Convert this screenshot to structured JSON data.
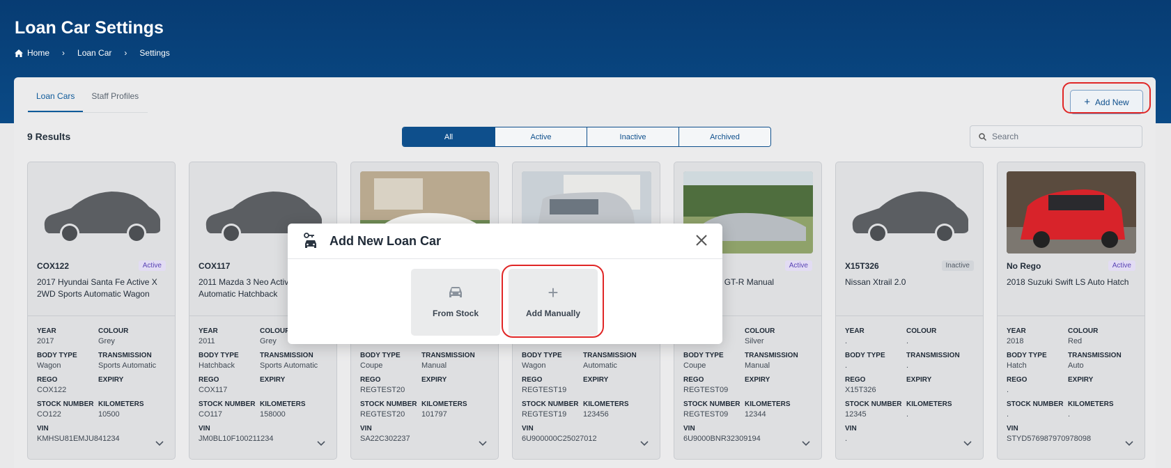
{
  "header": {
    "title": "Loan Car Settings",
    "breadcrumb": [
      "Home",
      "Loan Car",
      "Settings"
    ]
  },
  "tabs": [
    {
      "label": "Loan Cars",
      "active": true
    },
    {
      "label": "Staff Profiles",
      "active": false
    }
  ],
  "add_new_label": "Add New",
  "results_label": "9 Results",
  "filters": [
    {
      "label": "All",
      "active": true
    },
    {
      "label": "Active",
      "active": false
    },
    {
      "label": "Inactive",
      "active": false
    },
    {
      "label": "Archived",
      "active": false
    }
  ],
  "search": {
    "placeholder": "Search"
  },
  "labels": {
    "year": "YEAR",
    "colour": "COLOUR",
    "body_type": "BODY TYPE",
    "transmission": "TRANSMISSION",
    "rego": "REGO",
    "expiry": "EXPIRY",
    "stock_number": "STOCK NUMBER",
    "kilometers": "KILOMETERS",
    "vin": "VIN"
  },
  "cards": [
    {
      "rego_title": "COX122",
      "status": "Active",
      "name": "2017 Hyundai Santa Fe Active X 2WD Sports Automatic Wagon",
      "image": "placeholder",
      "year": "2017",
      "colour": "Grey",
      "body_type": "Wagon",
      "transmission": "Sports Automatic",
      "rego": "COX122",
      "expiry": "",
      "stock_number": "CO122",
      "kilometers": "10500",
      "vin": "KMHSU81EMJU841234"
    },
    {
      "rego_title": "COX117",
      "status": "Active",
      "name": "2011 Mazda 3 Neo Active Sports Automatic Hatchback",
      "image": "placeholder",
      "year": "2011",
      "colour": "Grey",
      "body_type": "Hatchback",
      "transmission": "Sports Automatic",
      "rego": "COX117",
      "expiry": "",
      "stock_number": "CO117",
      "kilometers": "158000",
      "vin": "JM0BL10F100211234"
    },
    {
      "rego_title": "",
      "status": "",
      "name": "",
      "image": "photo-white-coupe",
      "year": "",
      "colour": "",
      "body_type": "Coupe",
      "transmission": "Manual",
      "rego": "REGTEST20",
      "expiry": "",
      "stock_number": "REGTEST20",
      "kilometers": "101797",
      "vin": "SA22C302237"
    },
    {
      "rego_title": "",
      "status": "",
      "name": "",
      "image": "photo-silver-van",
      "year": "",
      "colour": "",
      "body_type": "Wagon",
      "transmission": "Automatic",
      "rego": "REGTEST19",
      "expiry": "",
      "stock_number": "REGTEST19",
      "kilometers": "123456",
      "vin": "6U900000C25027012"
    },
    {
      "rego_title": "",
      "status": "Active",
      "name": "an Skyline GT-R Manual",
      "image": "photo-silver-skyline",
      "year": "",
      "colour": "Silver",
      "body_type": "Coupe",
      "transmission": "Manual",
      "rego": "REGTEST09",
      "expiry": "",
      "stock_number": "REGTEST09",
      "kilometers": "12344",
      "vin": "6U9000BNR32309194"
    },
    {
      "rego_title": "X15T326",
      "status": "Inactive",
      "name": "Nissan Xtrail 2.0",
      "image": "placeholder",
      "year": ".",
      "colour": ".",
      "body_type": ".",
      "transmission": ".",
      "rego": "X15T326",
      "expiry": "",
      "stock_number": "12345",
      "kilometers": ".",
      "vin": "."
    },
    {
      "rego_title": "No Rego",
      "status": "Active",
      "name": "2018 Suzuki Swift LS Auto Hatch",
      "image": "photo-red-swift",
      "year": "2018",
      "colour": "Red",
      "body_type": "Hatch",
      "transmission": "Auto",
      "rego": ".",
      "expiry": "",
      "stock_number": ".",
      "kilometers": ".",
      "vin": "STYD576987970978098"
    }
  ],
  "modal": {
    "title": "Add New Loan Car",
    "options": [
      {
        "label": "From Stock",
        "icon": "car-icon"
      },
      {
        "label": "Add Manually",
        "icon": "plus-icon"
      }
    ]
  },
  "colors": {
    "header": "#073c73",
    "accent": "#0e4f8c",
    "highlight": "#e02626",
    "active_badge": "#5a44b5"
  }
}
